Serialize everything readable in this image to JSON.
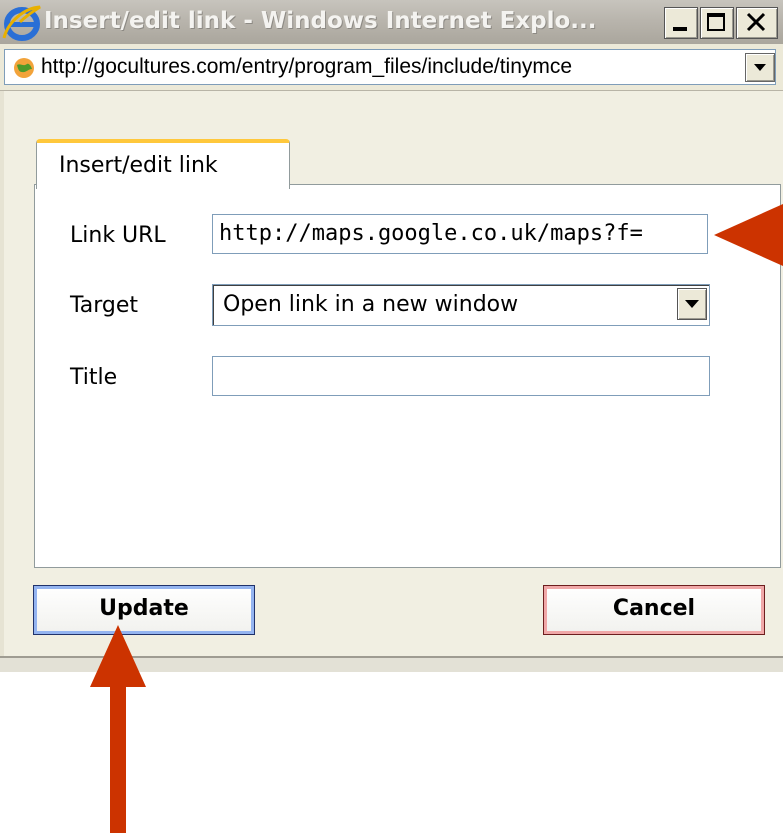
{
  "window": {
    "title": "Insert/edit link - Windows Internet Explo...",
    "url": "http://gocultures.com/entry/program_files/include/tinymce"
  },
  "icons": {
    "app": "internet-explorer-icon",
    "address": "globe-icon",
    "minimize": "minimize-icon",
    "maximize": "maximize-icon",
    "close": "close-icon",
    "dropdown": "chevron-down-icon",
    "annotation": "arrow-icon"
  },
  "dialog": {
    "tab_label": "Insert/edit link",
    "link_url_label": "Link URL",
    "link_url_value": "http://maps.google.co.uk/maps?f=",
    "target_label": "Target",
    "target_value": "Open link in a new window",
    "title_label": "Title",
    "title_value": "",
    "update_label": "Update",
    "cancel_label": "Cancel"
  },
  "colors": {
    "annotation_arrow": "#cc3300",
    "tab_accent": "#ffc83c",
    "update_border": "#94b4f0",
    "cancel_border": "#f0a8a8"
  }
}
